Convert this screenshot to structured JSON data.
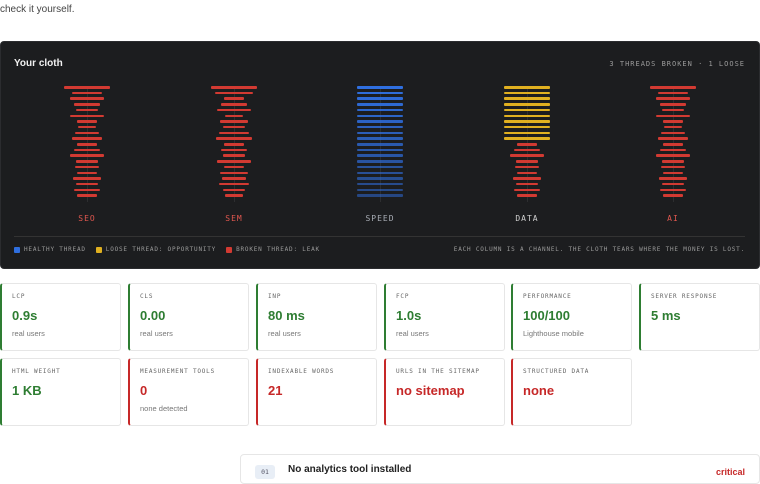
{
  "intro_text": "check it yourself.",
  "cloth": {
    "title": "Your cloth",
    "status": "3 THREADS BROKEN · 1 LOOSE",
    "colors": {
      "healthy": "#2f6fe0",
      "loose": "#e0b020",
      "broken": "#d23a32"
    },
    "columns": [
      {
        "label": "SEO",
        "state": "broken"
      },
      {
        "label": "SEM",
        "state": "broken"
      },
      {
        "label": "SPEED",
        "state": "healthy"
      },
      {
        "label": "DATA",
        "state": "loose"
      },
      {
        "label": "AI",
        "state": "broken"
      }
    ],
    "legend": [
      {
        "label": "HEALTHY THREAD",
        "color": "#2f6fe0"
      },
      {
        "label": "LOOSE THREAD: OPPORTUNITY",
        "color": "#e0b020"
      },
      {
        "label": "BROKEN THREAD: LEAK",
        "color": "#d23a32"
      }
    ],
    "note": "EACH COLUMN IS A CHANNEL. THE CLOTH TEARS WHERE THE MONEY IS LOST."
  },
  "metrics_row1": [
    {
      "label": "LCP",
      "value": "0.9s",
      "sub": "real users",
      "status": "good"
    },
    {
      "label": "CLS",
      "value": "0.00",
      "sub": "real users",
      "status": "good"
    },
    {
      "label": "INP",
      "value": "80 ms",
      "sub": "real users",
      "status": "good"
    },
    {
      "label": "FCP",
      "value": "1.0s",
      "sub": "real users",
      "status": "good"
    },
    {
      "label": "PERFORMANCE",
      "value": "100/100",
      "sub": "Lighthouse mobile",
      "status": "good"
    },
    {
      "label": "SERVER RESPONSE",
      "value": "5 ms",
      "sub": "",
      "status": "good"
    }
  ],
  "metrics_row2": [
    {
      "label": "HTML WEIGHT",
      "value": "1 KB",
      "sub": "",
      "status": "good"
    },
    {
      "label": "MEASUREMENT TOOLS",
      "value": "0",
      "sub": "none detected",
      "status": "bad"
    },
    {
      "label": "INDEXABLE WORDS",
      "value": "21",
      "sub": "",
      "status": "bad"
    },
    {
      "label": "URLS IN THE SITEMAP",
      "value": "no sitemap",
      "sub": "",
      "status": "bad"
    },
    {
      "label": "STRUCTURED DATA",
      "value": "none",
      "sub": "",
      "status": "bad"
    }
  ],
  "issue": {
    "number": "01",
    "title": "No analytics tool installed",
    "severity": "critical"
  }
}
